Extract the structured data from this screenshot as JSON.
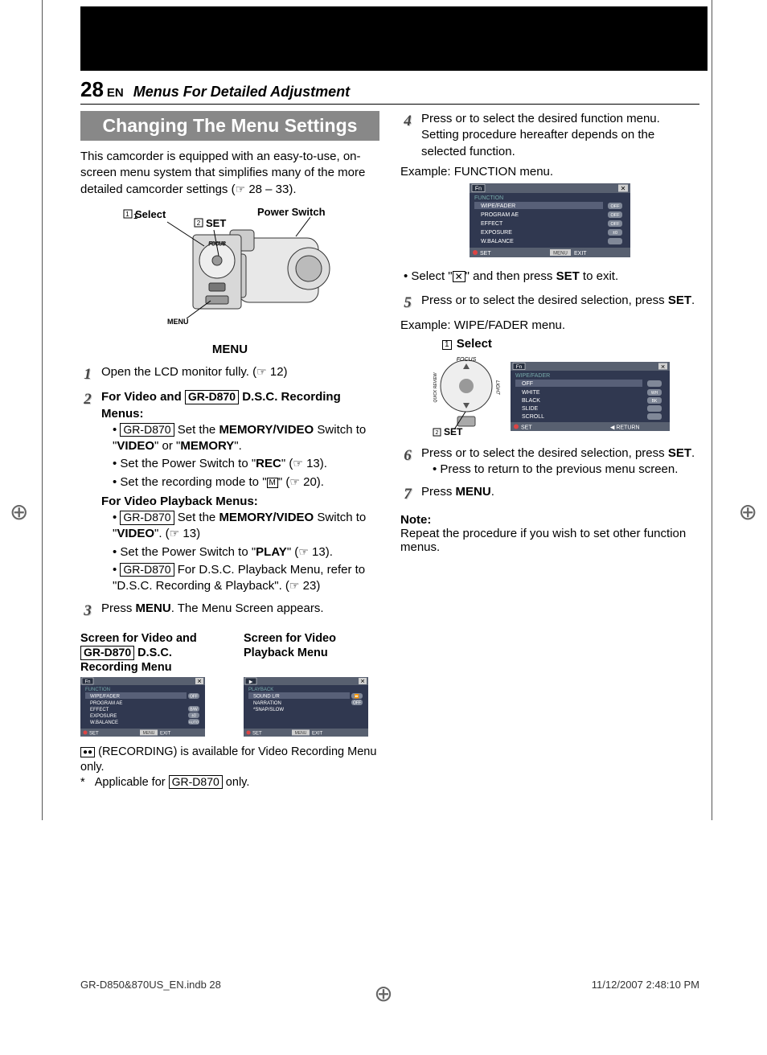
{
  "page": {
    "number": "28",
    "lang": "EN",
    "section_title": "Menus For Detailed Adjustment"
  },
  "banner": "Changing The Menu Settings",
  "intro": {
    "text_a": "This camcorder is equipped with an easy-to-use, on-screen menu system that simplifies many of the more detailed camcorder settings (",
    "pointer": "☞",
    "pages": " 28 – 33)."
  },
  "diagram": {
    "select_label": "Select",
    "set_label": "SET",
    "power_label": "Power Switch",
    "menu_word": "MENU",
    "menu_caption": "MENU",
    "focus": "FOCUS",
    "light": "LIGHT",
    "review": "QUICK REVIEW"
  },
  "boxed_model": "GR-D870",
  "step1": {
    "text": "Open the LCD monitor fully. (",
    "pageref": " 12)"
  },
  "step2": {
    "lead_a": "For Video and ",
    "lead_b": " D.S.C. Recording Menus:",
    "b1_a": " Set the ",
    "b1_b": "MEMORY/VIDEO",
    "b1_c": " Switch to \"",
    "b1_d": "VIDEO",
    "b1_e": "\" or \"",
    "b1_f": "MEMORY",
    "b1_g": "\".",
    "b2_a": "Set the Power Switch to \"",
    "b2_b": "REC",
    "b2_c": "\" (",
    "b2_d": " 13).",
    "b3_a": "Set the recording mode to \"",
    "b3_icon": "M",
    "b3_b": "\" (",
    "b3_c": " 20).",
    "play_h": "For Video Playback Menus:",
    "p1_a": " Set the ",
    "p1_b": "MEMORY/VIDEO",
    "p1_c": " Switch to \"",
    "p1_d": "VIDEO",
    "p1_e": "\". (",
    "p1_f": " 13)",
    "p2_a": "Set the Power Switch to \"",
    "p2_b": "PLAY",
    "p2_c": "\" (",
    "p2_d": " 13).",
    "p3_a": " For D.S.C. Playback Menu, refer to \"D.S.C. Recording & Playback\". (",
    "p3_b": " 23)"
  },
  "step3": {
    "a": "Press ",
    "b": "MENU",
    "c": ". The Menu Screen appears."
  },
  "screens": {
    "cap_rec_a": "Screen for Video and  ",
    "cap_rec_b": " D.S.C. Recording Menu",
    "cap_play": "Screen for Video Playback Menu"
  },
  "rec_screen": {
    "title": "FUNCTION",
    "items": [
      "WIPE/FADER",
      "PROGRAM AE",
      "EFFECT",
      "EXPOSURE",
      "W.BALANCE"
    ],
    "vals": [
      "OFF",
      "",
      "B/W",
      "±0",
      "AUTO"
    ],
    "set": "SET",
    "menu": "MENU",
    "exit": "EXIT",
    "icon": "Fn"
  },
  "play_screen": {
    "title": "PLAYBACK",
    "items": [
      "SOUND L/R",
      "NARRATION",
      "*SNAP/SLOW"
    ],
    "vals": [
      "",
      "OFF",
      ""
    ],
    "set": "SET",
    "menu": "MENU",
    "exit": "EXIT"
  },
  "footnotes": {
    "f1_a": " (RECORDING) is available for Video Recording Menu only.",
    "f2_a": "*",
    "f2_b": "Applicable for ",
    "f2_c": " only."
  },
  "step4": {
    "text": "Press      or      to select the desired function menu. Setting procedure hereafter depends on the selected function."
  },
  "example1": "Example: FUNCTION menu.",
  "func_screen": {
    "title": "FUNCTION",
    "items": [
      "WIPE/FADER",
      "PROGRAM AE",
      "EFFECT",
      "EXPOSURE",
      "W.BALANCE"
    ],
    "vals": [
      "OFF",
      "OFF",
      "OFF",
      "±0",
      ""
    ],
    "set": "SET",
    "menu": "MENU",
    "exit": "EXIT"
  },
  "exit_bullet": {
    "a": "Select \"",
    "x": "✕",
    "b": "\" and then press ",
    "c": "SET",
    "d": " to exit."
  },
  "step5": {
    "a": "Press      or      to select the desired selection, press ",
    "b": "SET",
    "c": "."
  },
  "example2": "Example: WIPE/FADER menu.",
  "wipe_fig": {
    "select_label": "Select",
    "set_label": "SET",
    "title": "WIPE/FADER",
    "items": [
      "OFF",
      "WHITE",
      "BLACK",
      "SLIDE",
      "SCROLL"
    ],
    "set": "SET",
    "return": "RETURN"
  },
  "step6": {
    "a": "Press      or      to select the desired selection, press ",
    "b": "SET",
    "c": ".",
    "sub_a": "Press     to return to the previous menu screen."
  },
  "step7": {
    "a": "Press ",
    "b": "MENU",
    "c": "."
  },
  "note": {
    "h": "Note:",
    "body": "Repeat the procedure if you wish to set other function menus."
  },
  "footer": {
    "file": "GR-D850&870US_EN.indb   28",
    "date": "11/12/2007   2:48:10 PM"
  }
}
